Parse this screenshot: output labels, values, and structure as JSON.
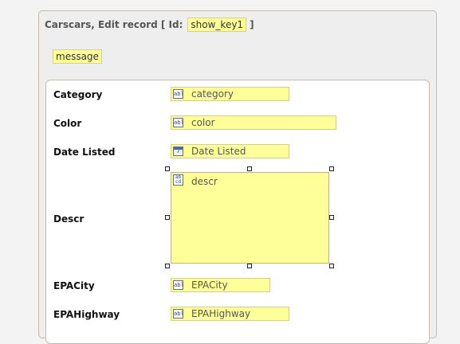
{
  "header": {
    "title": "Carscars, Edit record [ Id:",
    "key": "show_key1",
    "close_bracket": "]"
  },
  "message": "message",
  "fields": {
    "category": {
      "label": "Category",
      "value": "category",
      "icon": "text-field-icon"
    },
    "color": {
      "label": "Color",
      "value": "color",
      "icon": "text-field-icon"
    },
    "date_listed": {
      "label": "Date Listed",
      "value": "Date Listed",
      "icon": "calendar-icon"
    },
    "descr": {
      "label": "Descr",
      "value": "descr",
      "icon": "textarea-icon"
    },
    "epacity": {
      "label": "EPACity",
      "value": "EPACity",
      "icon": "text-field-icon"
    },
    "epahighway": {
      "label": "EPAHighway",
      "value": "EPAHighway",
      "icon": "text-field-icon"
    }
  },
  "colors": {
    "field_bg": "#ffff99",
    "panel_border": "#c9b9ab"
  }
}
